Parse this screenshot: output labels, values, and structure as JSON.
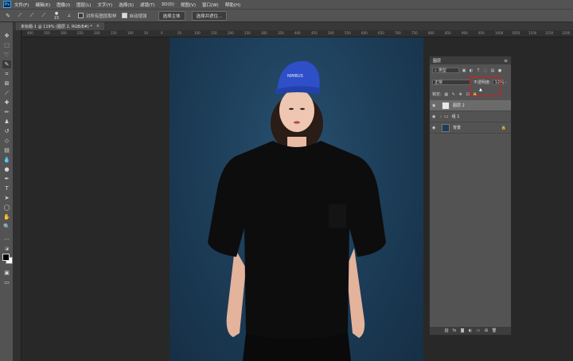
{
  "menubar": {
    "app_icon": "Ps",
    "items": [
      "文件(F)",
      "编辑(E)",
      "图像(I)",
      "图层(L)",
      "文字(Y)",
      "选择(S)",
      "滤镜(T)",
      "3D(D)",
      "视图(V)",
      "窗口(W)",
      "帮助(H)"
    ]
  },
  "options": {
    "auto_select_label": "对所有图层取样",
    "auto_enhance_label": "自动增强",
    "select_subject": "选择主体",
    "select_and_mask": "选择并遮住...",
    "brush_size": "15"
  },
  "document": {
    "tab_title": "未标题-1 @ 119% (图层 2, RGB/8#) *",
    "close": "×"
  },
  "ruler_h": [
    "400",
    "350",
    "300",
    "250",
    "200",
    "150",
    "100",
    "50",
    "0",
    "50",
    "100",
    "150",
    "200",
    "250",
    "300",
    "350",
    "400",
    "450",
    "500",
    "550",
    "600",
    "650",
    "700",
    "750",
    "800",
    "850",
    "900",
    "950",
    "1000",
    "1050",
    "1100",
    "1150",
    "1200"
  ],
  "photo": {
    "cap_text": "NIMBUS"
  },
  "layers_panel": {
    "title": "图层",
    "filter_label": "类型",
    "blend_mode": "正常",
    "opacity_label": "不透明度:",
    "opacity_value": "12%",
    "lock_label": "锁定:",
    "layers": [
      {
        "name": "图层 2",
        "selected": true,
        "type": "layer"
      },
      {
        "name": "组 1",
        "selected": false,
        "type": "group"
      },
      {
        "name": "背景",
        "selected": false,
        "type": "background"
      }
    ]
  },
  "colors": {
    "highlight": "#e01818",
    "accent": "#31a8ff"
  }
}
